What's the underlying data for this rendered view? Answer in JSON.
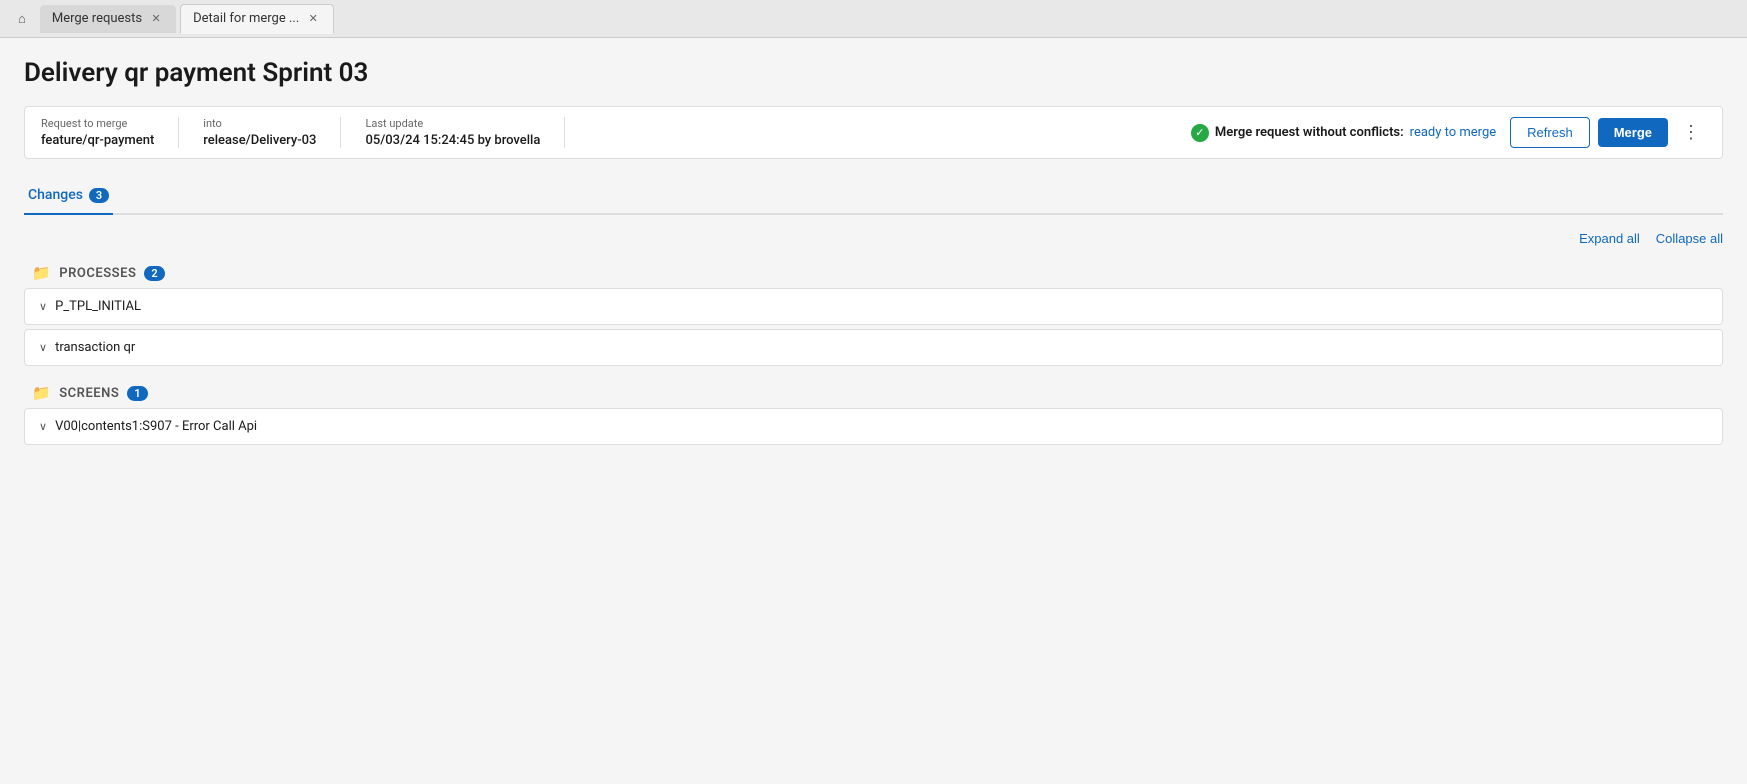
{
  "tabBar": {
    "homeIcon": "⌂",
    "tabs": [
      {
        "id": "merge-requests",
        "label": "Merge requests",
        "active": false,
        "closeable": true
      },
      {
        "id": "detail-merge",
        "label": "Detail for merge ...",
        "active": true,
        "closeable": true
      }
    ]
  },
  "page": {
    "title": "Delivery qr payment Sprint 03"
  },
  "metaBar": {
    "requestToMerge": {
      "label": "Request to merge",
      "value": "feature/qr-payment"
    },
    "into": {
      "label": "into",
      "value": "release/Delivery-03"
    },
    "lastUpdate": {
      "label": "Last update",
      "value": "05/03/24 15:24:45 by brovella"
    },
    "mergeStatus": {
      "statusLabel": "Merge request without conflicts:",
      "statusReady": "ready to merge"
    },
    "refreshBtn": "Refresh",
    "mergeBtn": "Merge"
  },
  "tabs": [
    {
      "id": "changes",
      "label": "Changes",
      "badge": "3",
      "active": true
    }
  ],
  "actions": {
    "expandAll": "Expand all",
    "collapseAll": "Collapse all"
  },
  "fileGroups": [
    {
      "id": "processes",
      "name": "PROCESSES",
      "badge": "2",
      "files": [
        {
          "id": "p-tpl-initial",
          "name": "P_TPL_INITIAL"
        },
        {
          "id": "transaction-qr",
          "name": "transaction qr"
        }
      ]
    },
    {
      "id": "screens",
      "name": "SCREENS",
      "badge": "1",
      "files": [
        {
          "id": "v00-contents",
          "name": "V00|contents1:S907 - Error Call Api"
        }
      ]
    }
  ]
}
